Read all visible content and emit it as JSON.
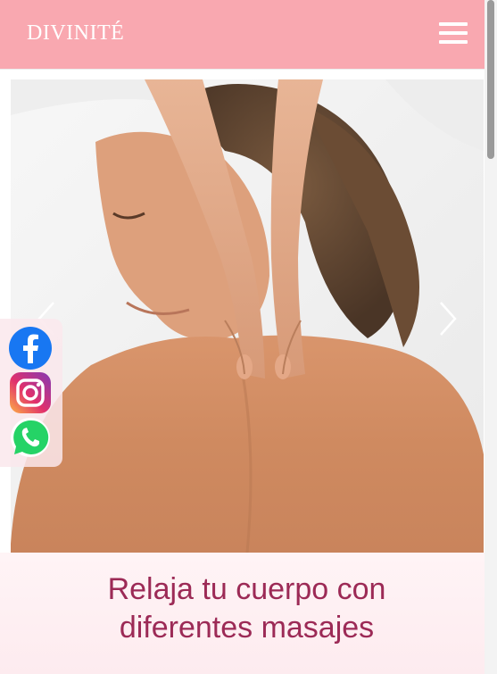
{
  "header": {
    "brand": "DIVINITÉ",
    "menu_icon": "hamburger-menu-icon"
  },
  "hero": {
    "prev_icon": "chevron-left-icon",
    "next_icon": "chevron-right-icon"
  },
  "social": [
    {
      "name": "Facebook",
      "icon": "facebook-icon",
      "color": "#1877f2"
    },
    {
      "name": "Instagram",
      "icon": "instagram-icon",
      "color": "#d6249f"
    },
    {
      "name": "WhatsApp",
      "icon": "whatsapp-icon",
      "color": "#25d366"
    }
  ],
  "caption": {
    "line1": "Relaja tu cuerpo con",
    "line2": "diferentes masajes"
  },
  "colors": {
    "header_bg": "#f9a8b0",
    "caption_text": "#9c2a56"
  }
}
